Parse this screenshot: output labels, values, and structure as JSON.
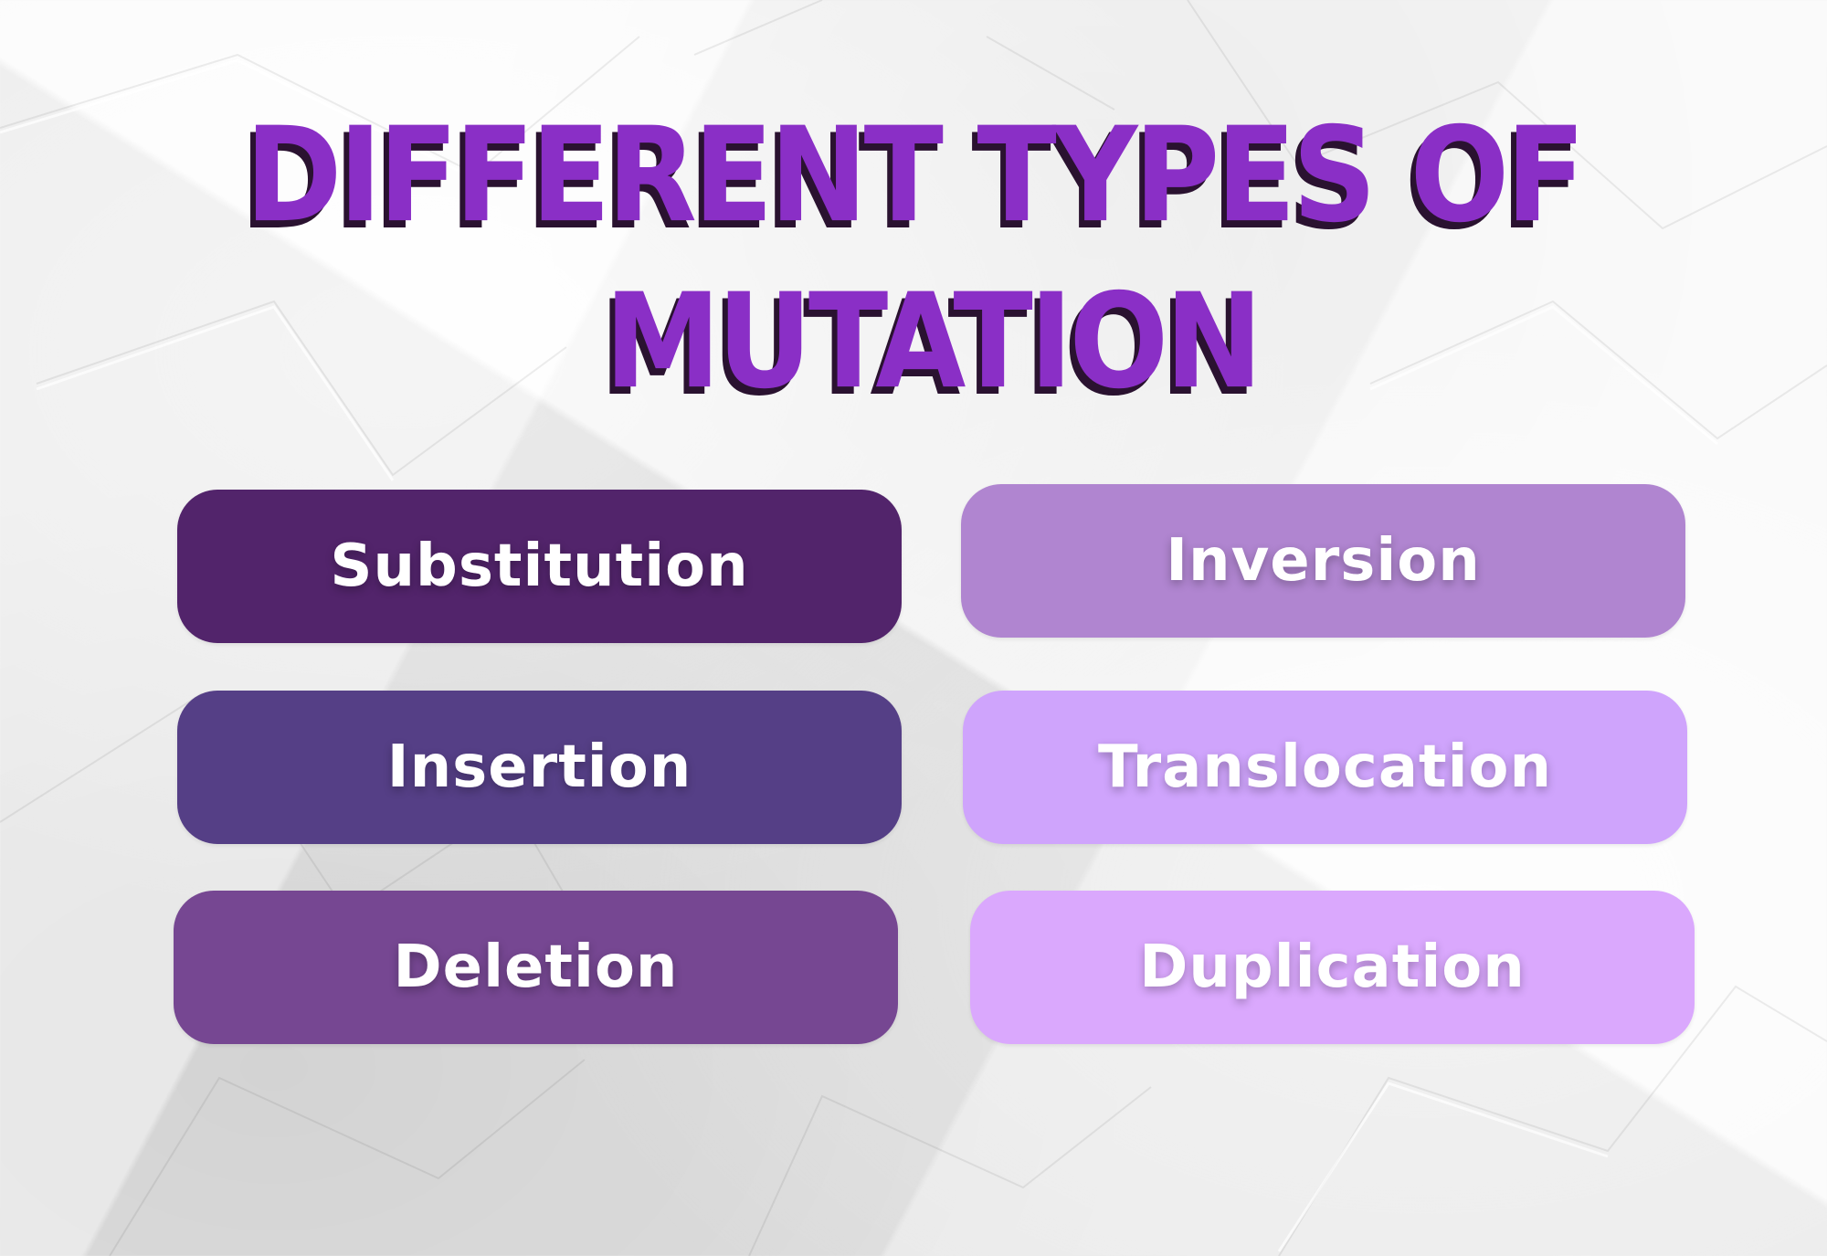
{
  "title": {
    "line1": "DIFFERENT TYPES  OF",
    "line2": "MUTATION",
    "color": "#8a2fc6"
  },
  "mutation_types": [
    {
      "label": "Substitution",
      "color": "#52246b"
    },
    {
      "label": "Inversion",
      "color": "#b085d0"
    },
    {
      "label": "Insertion",
      "color": "#553f86"
    },
    {
      "label": "Translocation",
      "color": "#cfa4fc"
    },
    {
      "label": "Deletion",
      "color": "#764792"
    },
    {
      "label": "Duplication",
      "color": "#daa8fd"
    }
  ]
}
